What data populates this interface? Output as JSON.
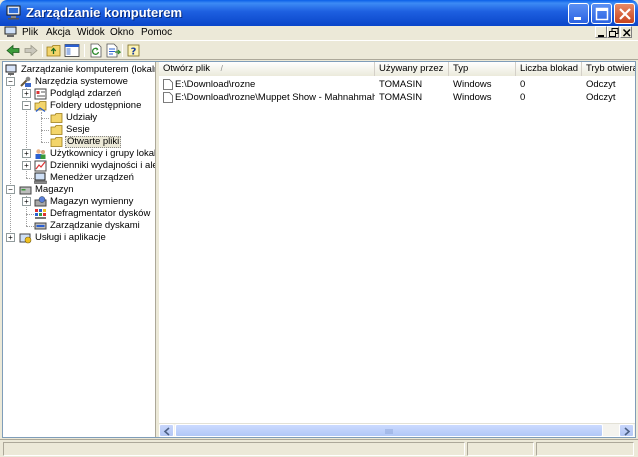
{
  "window": {
    "title": "Zarządzanie komputerem"
  },
  "menu": {
    "items": [
      "Plik",
      "Akcja",
      "Widok",
      "Okno",
      "Pomoc"
    ]
  },
  "toolbar": {
    "buttons": [
      "back-icon",
      "forward-icon",
      "up-folder-icon",
      "show-tree-icon",
      "refresh-icon",
      "export-icon",
      "help-icon"
    ]
  },
  "tree": {
    "root": "Zarządzanie komputerem (lokalne)",
    "system_tools": "Narzędzia systemowe",
    "event_viewer": "Podgląd zdarzeń",
    "shared_folders": "Foldery udostępnione",
    "shares": "Udziały",
    "sessions": "Sesje",
    "open_files": "Otwarte pliki",
    "local_users": "Użytkownicy i grupy lokalne",
    "perf_logs": "Dzienniki wydajności i alerty",
    "device_manager": "Menedżer urządzeń",
    "storage": "Magazyn",
    "removable_storage": "Magazyn wymienny",
    "defrag": "Defragmentator dysków",
    "disk_management": "Zarządzanie dyskami",
    "services_apps": "Usługi i aplikacje"
  },
  "list": {
    "columns": [
      "Otwórz plik",
      "Używany przez",
      "Typ",
      "Liczba blokad",
      "Tryb otwierania"
    ],
    "rows": [
      [
        "E:\\Download\\rozne",
        "TOMASIN",
        "Windows",
        "0",
        "Odczyt"
      ],
      [
        "E:\\Download\\rozne\\Muppet Show - Mahnahmahna.mpg",
        "TOMASIN",
        "Windows",
        "0",
        "Odczyt"
      ]
    ]
  },
  "colors": {
    "title_bar": "#0a46c9",
    "selection": "#ece9d8",
    "face": "#ece9d8"
  }
}
